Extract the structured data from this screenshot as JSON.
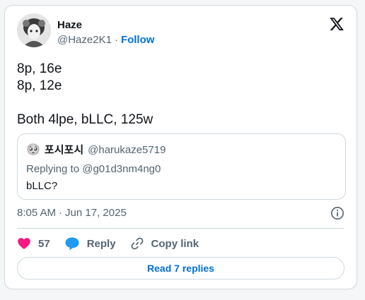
{
  "author": {
    "name": "Haze",
    "handle": "@Haze2K1",
    "separator": "·",
    "follow_label": "Follow"
  },
  "tweet": {
    "lines": [
      "8p, 16e",
      "8p, 12e",
      "",
      "Both 4lpe, bLLC, 125w"
    ]
  },
  "quote": {
    "emoji": "🥺",
    "name": "포시포시",
    "handle": "@harukaze5719",
    "replying_to": "Replying to @g01d3nm4ng0",
    "text": "bLLC?"
  },
  "meta": {
    "time": "8:05 AM",
    "separator": "·",
    "date": "Jun 17, 2025"
  },
  "actions": {
    "likes": "57",
    "reply_label": "Reply",
    "copy_label": "Copy link"
  },
  "read_replies_label": "Read 7 replies",
  "icons": {
    "brand": "x-logo-icon",
    "like": "heart-icon",
    "reply": "speech-bubble-icon",
    "copy": "link-icon",
    "info": "info-icon"
  },
  "colors": {
    "like": "#f91880",
    "reply": "#1d9bf0",
    "link": "#006fd6",
    "muted": "#536471",
    "border": "#cfd9de"
  }
}
